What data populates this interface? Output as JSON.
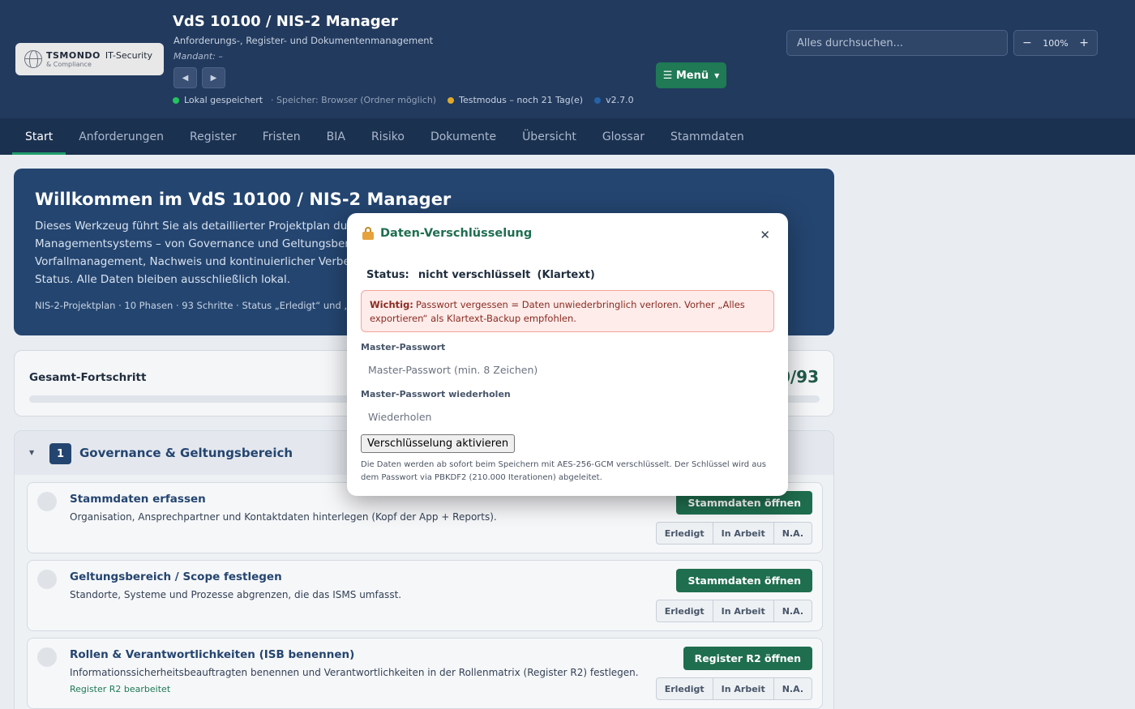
{
  "header": {
    "logo": {
      "name": "TSMONDO",
      "tagline": "IT-Security",
      "sub": "& Compliance"
    },
    "title": "VdS 10100 / NIS-2 Manager",
    "subtitle": "Anforderungs-, Register- und Dokumentenmanagement",
    "mandant": "Mandant: –",
    "prev_label": "◀",
    "next_label": "▶",
    "status": {
      "saved": "Lokal gespeichert",
      "storage": "· Speicher: Browser (Ordner möglich)",
      "testmode": "Testmodus – noch 21 Tag(e)",
      "version": "v2.7.0"
    },
    "menu_label": "☰ Menü",
    "menu_caret": "▼",
    "search_placeholder": "Alles durchsuchen...",
    "zoom": {
      "minus": "−",
      "value": "100%",
      "plus": "+"
    },
    "colors": {
      "saved": "#22c55e",
      "testmode": "#e0a92a",
      "version": "#2563a8"
    }
  },
  "tabs": [
    "Start",
    "Anforderungen",
    "Register",
    "Fristen",
    "BIA",
    "Risiko",
    "Dokumente",
    "Übersicht",
    "Glossar",
    "Stammdaten"
  ],
  "active_tab": "Start",
  "welcome": {
    "title": "Willkommen im VdS 10100 / NIS-2 Manager",
    "text": "Dieses Werkzeug führt Sie als detaillierter Projektplan durch den Aufbau Ihres Managementsystems – von Governance und Geltungsbereich über Register bis zu Vorfallmanagement, Nachweis und kontinuierlicher Verbesserung. Setzen Sie je Schritt den Status. Alle Daten bleiben ausschließlich lokal.",
    "meta": "NIS-2-Projektplan · 10 Phasen · 93 Schritte · Status „Erledigt“ und „N.A.“ ..."
  },
  "progress": {
    "label": "Gesamt-Fortschritt",
    "count": "0/93",
    "fraction": 0
  },
  "phase": {
    "toggle": "▼",
    "number": "1",
    "title": "Governance & Geltungsbereich",
    "steps": [
      {
        "title": "Stammdaten erfassen",
        "desc": "Organisation, Ansprechpartner und Kontaktdaten hinterlegen (Kopf der App + Reports).",
        "note": "",
        "action": "Stammdaten öffnen"
      },
      {
        "title": "Geltungsbereich / Scope festlegen",
        "desc": "Standorte, Systeme und Prozesse abgrenzen, die das ISMS umfasst.",
        "note": "",
        "action": "Stammdaten öffnen"
      },
      {
        "title": "Rollen & Verantwortlichkeiten (ISB benennen)",
        "desc": "Informationssicherheitsbeauftragten benennen und Verantwortlichkeiten in der Rollenmatrix (Register R2) festlegen.",
        "note": "Register R2 bearbeitet",
        "action": "Register R2 öffnen"
      }
    ],
    "status_options": [
      "Erledigt",
      "In Arbeit",
      "N.A."
    ]
  },
  "modal": {
    "icon": "lock-icon",
    "title": "Daten-Verschlüsselung",
    "close": "✕",
    "status_label": "Status:",
    "status_value": "nicht verschlüsselt",
    "status_extra": "(Klartext)",
    "warning_strong": "Wichtig:",
    "warning_text": "Passwort vergessen = Daten unwiederbringlich verloren. Vorher „Alles exportieren“ als Klartext-Backup empfohlen.",
    "password_label": "Master-Passwort",
    "password_placeholder": "Master-Passwort (min. 8 Zeichen)",
    "repeat_label": "Master-Passwort wiederholen",
    "repeat_placeholder": "Wiederholen",
    "activate_label": "Verschlüsselung aktivieren",
    "footnote": "Die Daten werden ab sofort beim Speichern mit AES-256-GCM verschlüsselt. Der Schlüssel wird aus dem Passwort via PBKDF2 (210.000 Iterationen) abgeleitet."
  }
}
